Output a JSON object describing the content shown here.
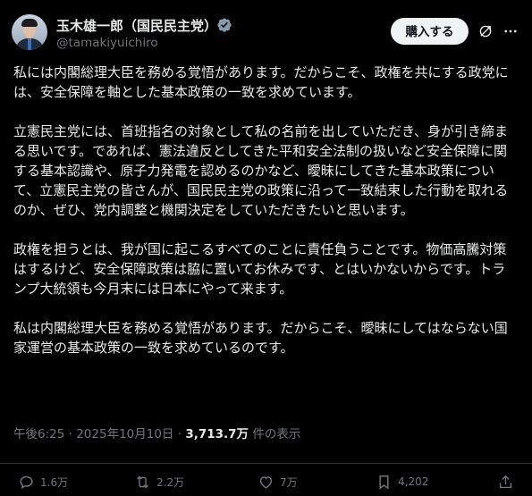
{
  "author": {
    "display_name": "玉木雄一郎（国民民主党）",
    "handle": "@tamakiyuichiro"
  },
  "header": {
    "buy_label": "購入する"
  },
  "post": {
    "paragraphs": [
      "私には内閣総理大臣を務める覚悟があります。だからこそ、政権を共にする政党には、安全保障を軸とした基本政策の一致を求めています。",
      "立憲民主党には、首班指名の対象として私の名前を出していただき、身が引き締まる思いです。であれば、憲法違反としてきた平和安全法制の扱いなど安全保障に関する基本認識や、原子力発電を認めるのかなど、曖昧にしてきた基本政策について、立憲民主党の皆さんが、国民民主党の政策に沿って一致結束した行動を取れるのか、ぜひ、党内調整と機関決定をしていただきたいと思います。",
      "政権を担うとは、我が国に起こるすべてのことに責任負うことです。物価高騰対策はするけど、安全保障政策は脇に置いてお休みです、とはいかないからです。トランプ大統領も今月末には日本にやって来ます。",
      "私は内閣総理大臣を務める覚悟があります。だからこそ、曖昧にしてはならない国家運営の基本政策の一致を求めているのです。"
    ]
  },
  "meta": {
    "time": "午後6:25",
    "separator": "·",
    "date": "2025年10月10日",
    "views_count": "3,713.7万",
    "views_label": "件の表示"
  },
  "actions": {
    "reply_count": "1.6万",
    "repost_count": "2.2万",
    "like_count": "7万",
    "bookmark_count": "4,202"
  },
  "icons": {
    "verified": "verified-badge-icon",
    "grok": "grok-icon",
    "more": "more-icon",
    "reply": "reply-icon",
    "repost": "repost-icon",
    "like": "like-icon",
    "bookmark": "bookmark-icon",
    "share": "share-icon"
  },
  "colors": {
    "background": "#000000",
    "text": "#e7e9ea",
    "secondary": "#71767b",
    "verified_badge": "#829aab",
    "button_bg": "#eff3f4"
  }
}
